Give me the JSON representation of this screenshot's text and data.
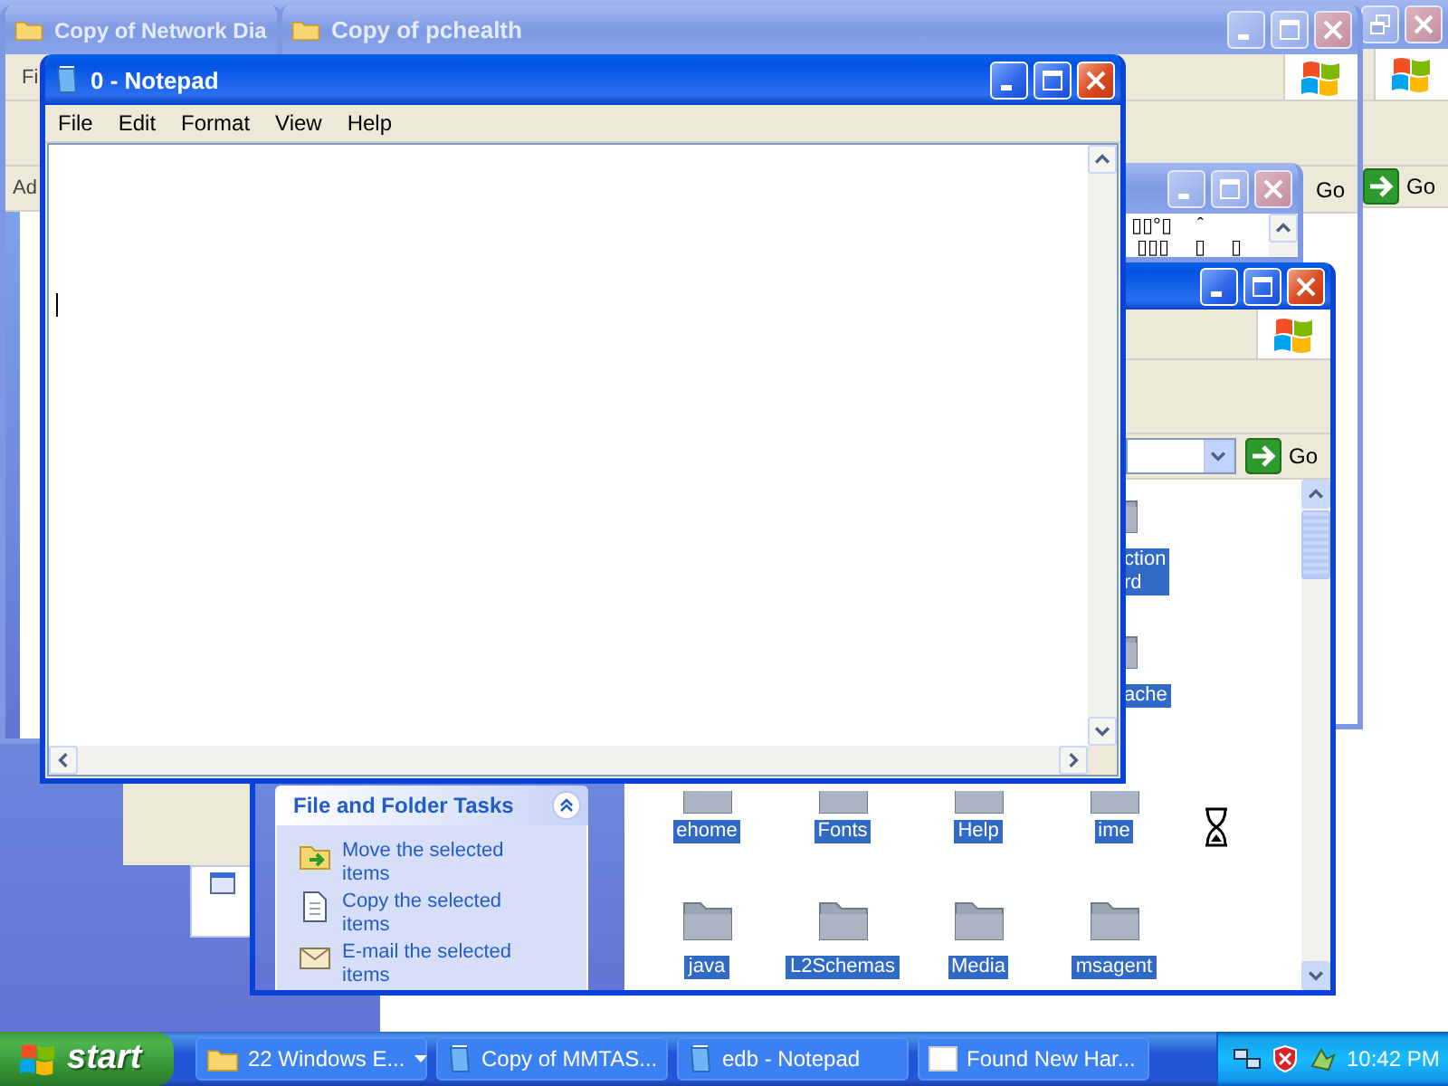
{
  "background_window": {
    "active": false,
    "caption_buttons": [
      {
        "kind": "restore"
      },
      {
        "kind": "close"
      }
    ],
    "go_label": "Go"
  },
  "network_window": {
    "active": false,
    "title": "Copy of Network Dia",
    "menu_fragment": "Fi",
    "address_fragment": "Ad"
  },
  "pchealth_window": {
    "active": false,
    "title": "Copy of pchealth",
    "caption_buttons": [
      {
        "kind": "minimize"
      },
      {
        "kind": "maximize"
      },
      {
        "kind": "close"
      }
    ],
    "go_label": "Go"
  },
  "garbled_window": {
    "active": false,
    "caption_buttons": [
      {
        "kind": "minimize"
      },
      {
        "kind": "maximize"
      },
      {
        "kind": "close"
      }
    ],
    "lines": [
      [
        "▯▯°▯",
        "ˆ"
      ],
      [
        "▯▯▯",
        "▯",
        "▯"
      ]
    ]
  },
  "explorer_window": {
    "active": true,
    "caption_buttons": [
      {
        "kind": "minimize"
      },
      {
        "kind": "maximize"
      },
      {
        "kind": "close"
      }
    ],
    "go_label": "Go",
    "task_pane": {
      "title": "File and Folder Tasks",
      "tasks": [
        {
          "kind": "move",
          "label": "Move the selected items"
        },
        {
          "kind": "copy",
          "label": "Copy the selected items"
        },
        {
          "kind": "email",
          "label": "E-mail the selected items"
        }
      ]
    },
    "items": [
      {
        "kind": "side-clipped",
        "label": "ction\nrd",
        "selected": true
      },
      {
        "kind": "side-clipped",
        "label": "ache",
        "selected": true
      },
      {
        "kind": "top-clipped",
        "label": "ehome",
        "selected": true
      },
      {
        "kind": "top-clipped",
        "label": "Fonts",
        "selected": true
      },
      {
        "kind": "top-clipped",
        "label": "Help",
        "selected": true
      },
      {
        "kind": "top-clipped",
        "label": "ime",
        "selected": true
      },
      {
        "kind": "folder",
        "label": "java",
        "selected": true
      },
      {
        "kind": "folder",
        "label": "L2Schemas",
        "selected": true
      },
      {
        "kind": "folder",
        "label": "Media",
        "selected": true
      },
      {
        "kind": "folder",
        "label": "msagent",
        "selected": true
      }
    ]
  },
  "notepad": {
    "active": true,
    "title": "0 - Notepad",
    "caption_buttons": [
      {
        "kind": "minimize"
      },
      {
        "kind": "maximize"
      },
      {
        "kind": "close"
      }
    ],
    "menu": [
      "File",
      "Edit",
      "Format",
      "View",
      "Help"
    ]
  },
  "taskbar": {
    "start": "start",
    "buttons": [
      {
        "kind": "folder-group",
        "label": "22 Windows E..."
      },
      {
        "kind": "document",
        "label": "Copy of MMTAS..."
      },
      {
        "kind": "notepad",
        "label": "edb - Notepad"
      },
      {
        "kind": "dialog",
        "label": "Found New Har..."
      }
    ],
    "clock": "10:42 PM"
  }
}
